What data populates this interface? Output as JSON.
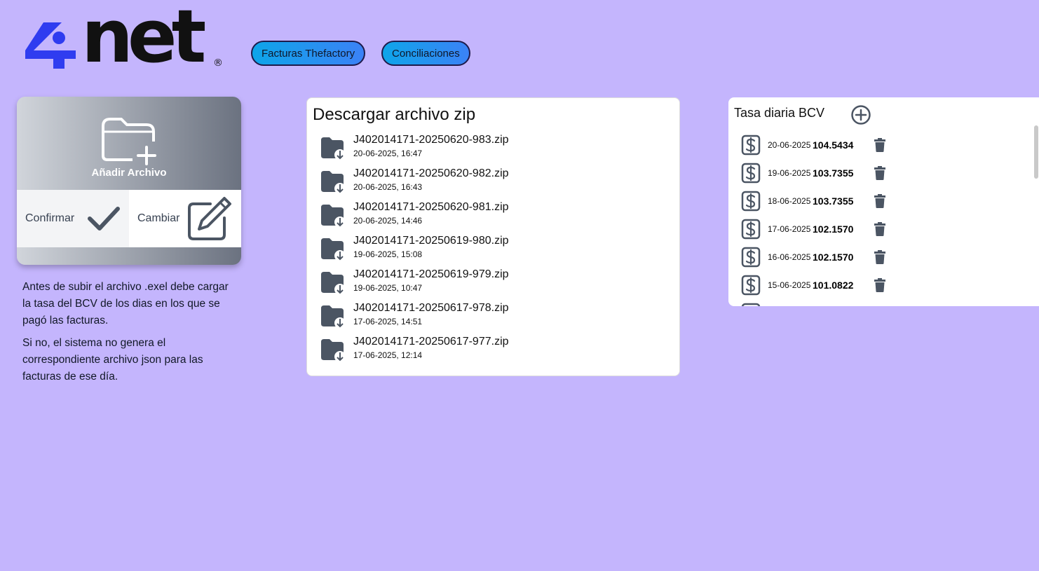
{
  "brand": {
    "name": "net",
    "mark": "4",
    "registered": "®"
  },
  "nav": [
    {
      "label": "Facturas Thefactory"
    },
    {
      "label": "Conciliaciones"
    }
  ],
  "upload": {
    "add_label": "Añadir Archivo",
    "confirm_label": "Confirmar",
    "change_label": "Cambiar"
  },
  "info": {
    "p1": "Antes de subir el archivo .exel debe cargar la tasa del BCV de los dias en los que se pagó las facturas.",
    "p2": "Si no, el sistema no genera el correspondiente archivo json para las facturas de ese día."
  },
  "zip": {
    "title": "Descargar archivo zip",
    "files": [
      {
        "name": "J402014171-20250620-983.zip",
        "date": "20-06-2025, 16:47"
      },
      {
        "name": "J402014171-20250620-982.zip",
        "date": "20-06-2025, 16:43"
      },
      {
        "name": "J402014171-20250620-981.zip",
        "date": "20-06-2025, 14:46"
      },
      {
        "name": "J402014171-20250619-980.zip",
        "date": "19-06-2025, 15:08"
      },
      {
        "name": "J402014171-20250619-979.zip",
        "date": "19-06-2025, 10:47"
      },
      {
        "name": "J402014171-20250617-978.zip",
        "date": "17-06-2025, 14:51"
      },
      {
        "name": "J402014171-20250617-977.zip",
        "date": "17-06-2025, 12:14"
      }
    ]
  },
  "bcv": {
    "title": "Tasa diaria BCV",
    "rates": [
      {
        "date": "20-06-2025",
        "value": "104.5434"
      },
      {
        "date": "19-06-2025",
        "value": "103.7355"
      },
      {
        "date": "18-06-2025",
        "value": "103.7355"
      },
      {
        "date": "17-06-2025",
        "value": "102.1570"
      },
      {
        "date": "16-06-2025",
        "value": "102.1570"
      },
      {
        "date": "15-06-2025",
        "value": "101.0822"
      }
    ]
  },
  "colors": {
    "background": "#c4b5fd",
    "brand_blue": "#2f3cf0",
    "icon_gray": "#4b5563"
  }
}
